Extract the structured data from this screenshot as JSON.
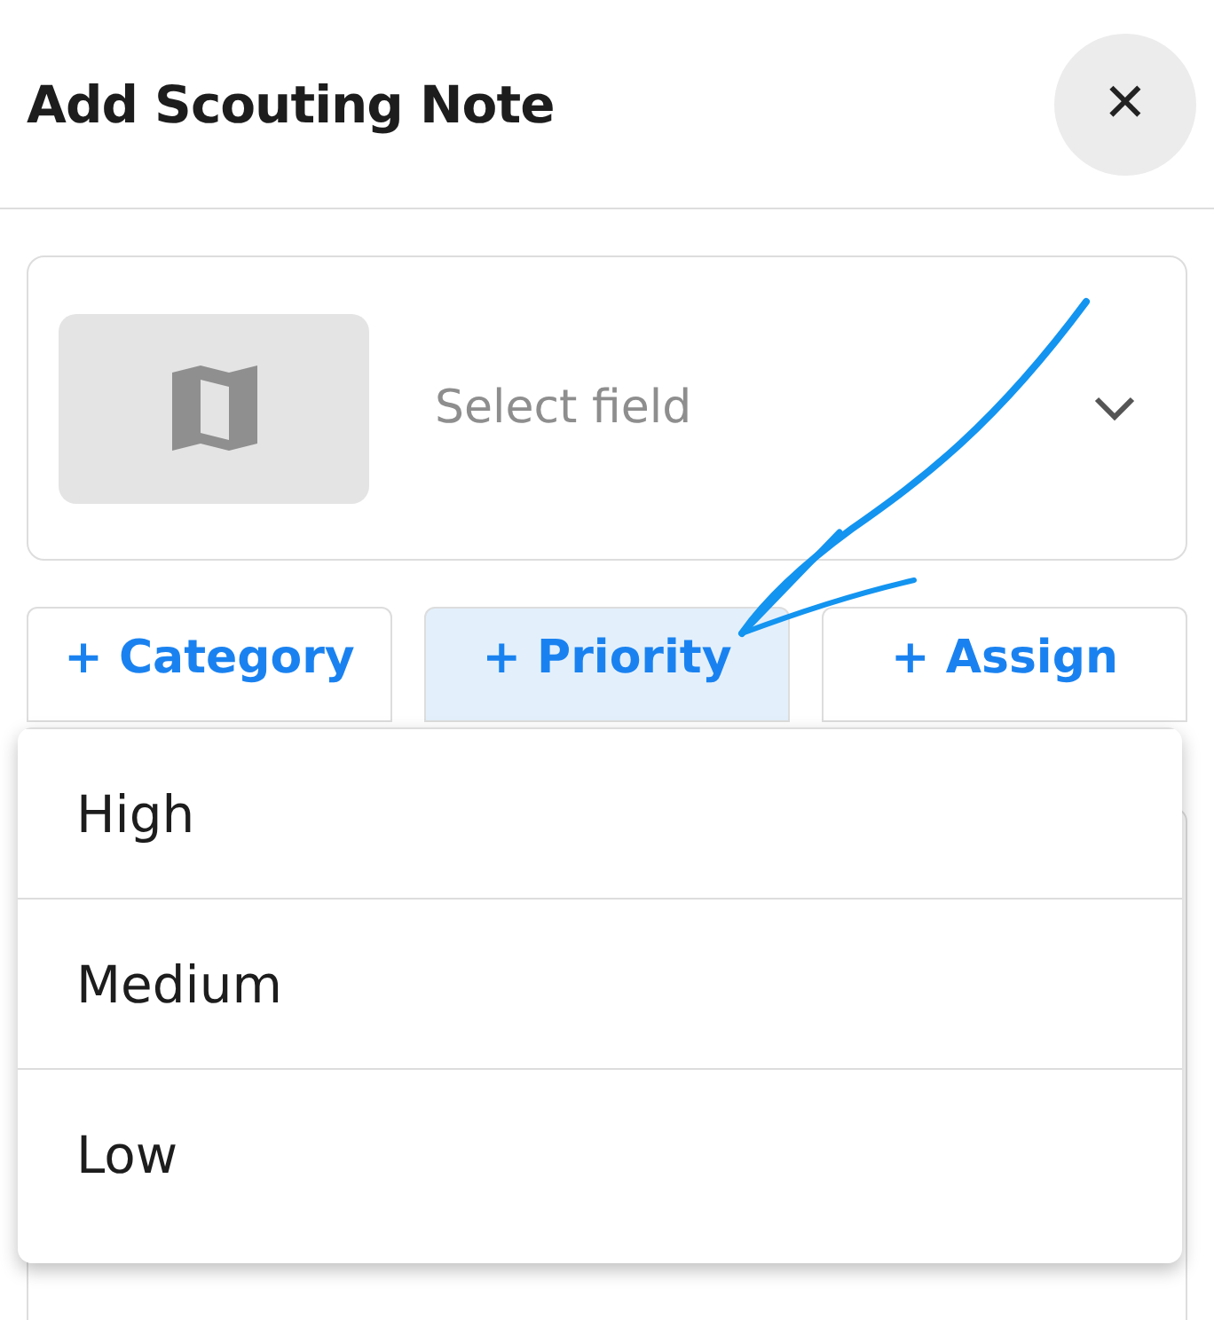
{
  "header": {
    "title": "Add Scouting Note",
    "close_label": "✕"
  },
  "field_select": {
    "placeholder": "Select field"
  },
  "chips": [
    {
      "label": "+ Category",
      "selected": false
    },
    {
      "label": "+ Priority",
      "selected": true
    },
    {
      "label": "+ Assign",
      "selected": false
    }
  ],
  "dropdown": {
    "items": [
      {
        "label": "High"
      },
      {
        "label": "Medium"
      },
      {
        "label": "Low"
      }
    ]
  }
}
